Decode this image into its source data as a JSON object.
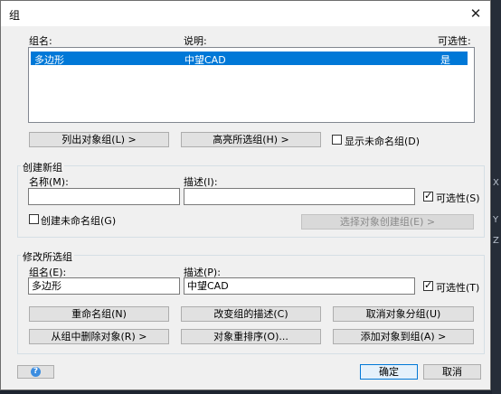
{
  "dialog": {
    "title": "组",
    "close_glyph": "✕"
  },
  "groups_list": {
    "headers": {
      "name": "组名:",
      "desc": "说明:",
      "selectable": "可选性:"
    },
    "rows": [
      {
        "name": "多边形",
        "desc": "中望CAD",
        "selectable": "是"
      }
    ]
  },
  "top_buttons": {
    "list_groups": "列出对象组(L) >",
    "highlight": "高亮所选组(H) >",
    "show_unnamed": "显示未命名组(D)",
    "show_unnamed_checked": false
  },
  "create_group": {
    "title": "创建新组",
    "name_label": "名称(M):",
    "name_value": "",
    "desc_label": "描述(I):",
    "desc_value": "",
    "selectable_label": "可选性(S)",
    "selectable_checked": true,
    "unnamed_label": "创建未命名组(G)",
    "unnamed_checked": false,
    "select_objects_button": "选择对象创建组(E) >"
  },
  "modify_group": {
    "title": "修改所选组",
    "name_label": "组名(E):",
    "name_value": "多边形",
    "desc_label": "描述(P):",
    "desc_value": "中望CAD",
    "selectable_label": "可选性(T)",
    "selectable_checked": true,
    "rename": "重命名组(N)",
    "change_desc": "改变组的描述(C)",
    "ungroup": "取消对象分组(U)",
    "remove_objects": "从组中删除对象(R) >",
    "reorder": "对象重排序(O)...",
    "add_objects": "添加对象到组(A) >"
  },
  "footer": {
    "ok": "确定",
    "cancel": "取消",
    "help_glyph": "?"
  },
  "background_edge": {
    "glyphs": [
      "X",
      "Y",
      "Z"
    ]
  },
  "colors": {
    "selection": "#0078d7",
    "dialog_bg": "#f0f0f0",
    "accent_border": "#0078d7"
  }
}
